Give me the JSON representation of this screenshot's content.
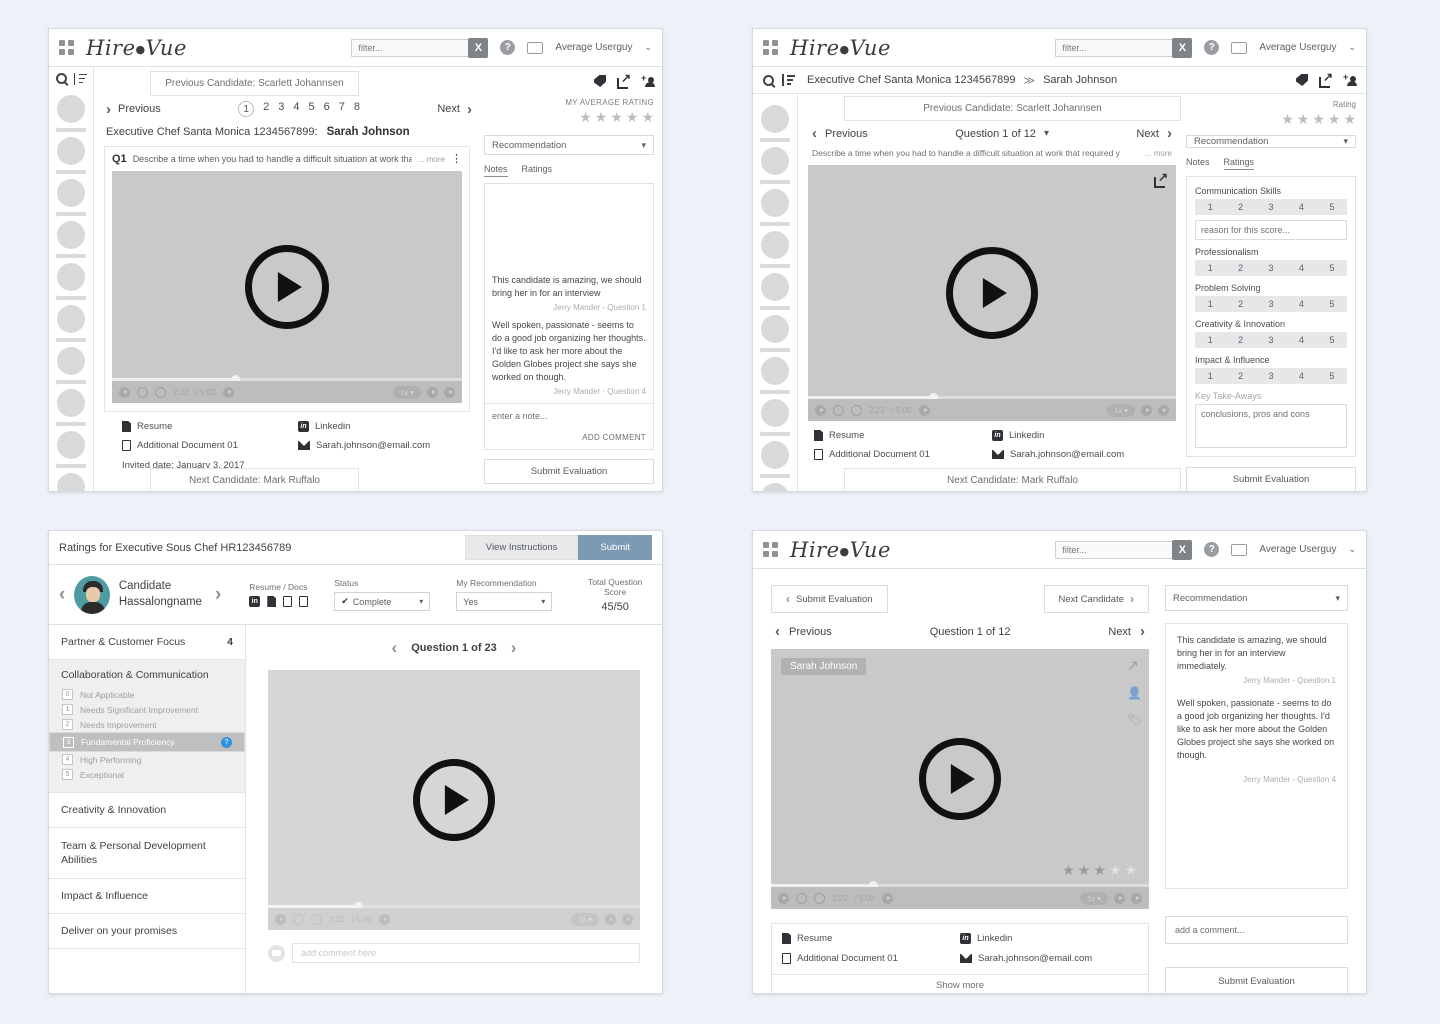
{
  "topbar": {
    "logo": "Hire",
    "logo2": "Vue",
    "filter_placeholder": "filter...",
    "clear_label": "X",
    "help_label": "?",
    "user": "Average Userguy",
    "caret": "⌄"
  },
  "panel_tl": {
    "prev_candidate_banner": "Previous Candidate: Scarlett Johannsen",
    "next_candidate_banner": "Next Candidate: Mark Ruffalo",
    "previous_label": "Previous",
    "next_label": "Next",
    "pages": [
      "1",
      "2",
      "3",
      "4",
      "5",
      "6",
      "7",
      "8"
    ],
    "active_page": "1",
    "position_title": "Executive Chef Santa Monica 1234567899:",
    "candidate_name": "Sarah Johnson",
    "avg_rating_label": "MY AVERAGE RATING",
    "stars": 5,
    "stars_filled": 0,
    "question_number": "Q1",
    "question_text": "Describe a time when you had to handle a difficult situation at work tha",
    "more_label": "... more",
    "recommendation_label": "Recommendation",
    "tabs": [
      "Notes",
      "Ratings"
    ],
    "active_tab": "Notes",
    "notes": [
      {
        "text": "This candidate is amazing, we should bring her in for an interview",
        "author": "Jerry Mander - Question 1"
      },
      {
        "text": "Well spoken, passionate - seems to do a good job organizing her thoughts. I'd like to ask her more about the Golden Globes project she says she worked on though.",
        "author": "Jerry Mander - Question 4"
      }
    ],
    "note_placeholder": "enter a note...",
    "add_comment_label": "ADD COMMENT",
    "submit_label": "Submit Evaluation",
    "attachments": [
      {
        "label": "Resume",
        "icon": "document-icon"
      },
      {
        "label": "Additional Document 01",
        "icon": "document-outline-icon"
      }
    ],
    "contacts": [
      {
        "label": "Linkedin",
        "icon": "linkedin-icon"
      },
      {
        "label": "Sarah.johnson@email.com",
        "icon": "mail-icon"
      }
    ],
    "invited_date": "Invited date: January 3, 2017",
    "video": {
      "current_time": "2:22",
      "duration": "/ 5:00",
      "speed": "1x ▾",
      "progress_pct": 36
    }
  },
  "panel_tr": {
    "breadcrumb_position": "Executive Chef Santa Monica 1234567899",
    "breadcrumb_sep": "≫",
    "breadcrumb_candidate": "Sarah Johnson",
    "prev_candidate_banner": "Previous Candidate: Scarlett Johannsen",
    "next_candidate_banner": "Next Candidate: Mark Ruffalo",
    "previous_label": "Previous",
    "next_label": "Next",
    "question_counter": "Question 1 of 12",
    "question_text": "Describe a time when you had to handle a difficult situation at work that required y",
    "more_label": "... more",
    "rating_label": "Rating",
    "stars": 5,
    "recommendation_label": "Recommendation",
    "tabs": [
      "Notes",
      "Ratings"
    ],
    "active_tab": "Ratings",
    "rating_scale": [
      "1",
      "2",
      "3",
      "4",
      "5"
    ],
    "criteria": [
      {
        "name": "Communication Skills",
        "has_reason": true,
        "reason_placeholder": "reason for this score..."
      },
      {
        "name": "Professionalism",
        "has_reason": false
      },
      {
        "name": "Problem Solving",
        "has_reason": false
      },
      {
        "name": "Creativity & Innovation",
        "has_reason": false
      },
      {
        "name": "Impact & Influence",
        "has_reason": false
      }
    ],
    "takeaways_label": "Key Take-Aways",
    "takeaways_value": "conclusions, pros and cons",
    "submit_label": "Submit Evaluation",
    "attachments": [
      {
        "label": "Resume",
        "icon": "document-icon"
      },
      {
        "label": "Additional Document 01",
        "icon": "document-outline-icon"
      }
    ],
    "contacts": [
      {
        "label": "Linkedin",
        "icon": "linkedin-icon"
      },
      {
        "label": "Sarah.johnson@email.com",
        "icon": "mail-icon"
      }
    ],
    "video": {
      "current_time": "2:22",
      "duration": "/ 5:00",
      "speed": "1x ▾",
      "progress_pct": 35
    }
  },
  "panel_bl": {
    "title": "Ratings for Executive Sous Chef HR123456789",
    "view_instructions_label": "View Instructions",
    "submit_label": "Submit",
    "candidate_name_line1": "Candidate",
    "candidate_name_line2": "Hassalongname",
    "meta": [
      {
        "label": "Resume / Docs",
        "value": ""
      },
      {
        "label": "Status",
        "value": "Complete"
      },
      {
        "label": "My Recommendation",
        "value": "Yes"
      },
      {
        "label": "Total Question Score",
        "value": "45/50"
      }
    ],
    "categories": [
      {
        "name": "Partner & Customer Focus",
        "score": "4",
        "expanded": false
      },
      {
        "name": "Collaboration & Communication",
        "score": "",
        "expanded": true
      },
      {
        "name": "Creativity & Innovation",
        "score": "",
        "expanded": false
      },
      {
        "name": "Team & Personal Development Abilities",
        "score": "",
        "expanded": false
      },
      {
        "name": "Impact & Influence",
        "score": "",
        "expanded": false
      },
      {
        "name": "Deliver on your promises",
        "score": "",
        "expanded": false
      }
    ],
    "options": [
      {
        "num": "0",
        "label": "Not Applicable",
        "selected": false
      },
      {
        "num": "1",
        "label": "Needs Significant Improvement",
        "selected": false
      },
      {
        "num": "2",
        "label": "Needs Improvement",
        "selected": false
      },
      {
        "num": "3",
        "label": "Fundamental Proficiency",
        "selected": true
      },
      {
        "num": "4",
        "label": "High Performing",
        "selected": false
      },
      {
        "num": "5",
        "label": "Exceptional",
        "selected": false
      }
    ],
    "question_counter": "Question 1 of 23",
    "comment_placeholder": "add comment here",
    "video": {
      "current_time": "2:22",
      "duration": "/ 5:00",
      "speed": "1x ▾",
      "progress_pct": 25
    }
  },
  "panel_br": {
    "submit_eval_label": "Submit Evaluation",
    "next_candidate_label": "Next Candidate",
    "recommendation_label": "Recommendation",
    "previous_label": "Previous",
    "next_label": "Next",
    "question_counter": "Question 1 of 12",
    "name_chip": "Sarah Johnson",
    "stars": 5,
    "stars_filled": 3,
    "notes": [
      {
        "text": "This candidate is amazing, we should bring her in for an interview immediately.",
        "author": "Jerry Mander - Question 1"
      },
      {
        "text": "Well spoken, passionate - seems to do a good job organizing her thoughts. I'd like to ask her more about the Golden Globes project she says she worked on though.",
        "author": "Jerry Mander - Question 4"
      }
    ],
    "comment_placeholder": "add a comment...",
    "submit_label": "Submit Evaluation",
    "attachments": [
      {
        "label": "Resume",
        "icon": "document-icon"
      },
      {
        "label": "Additional Document 01",
        "icon": "document-outline-icon"
      }
    ],
    "contacts": [
      {
        "label": "Linkedin",
        "icon": "linkedin-icon"
      },
      {
        "label": "Sarah.johnson@email.com",
        "icon": "mail-icon"
      }
    ],
    "show_more_label": "Show more",
    "video": {
      "current_time": "2:22",
      "duration": "/ 5:00",
      "speed": "1x ▾",
      "progress_pct": 28
    }
  },
  "colors": {
    "accent_blue": "#7d9ab5",
    "info_blue": "#2f93e0",
    "background": "#eef1f7",
    "video_grey": "#c9c9c9"
  }
}
